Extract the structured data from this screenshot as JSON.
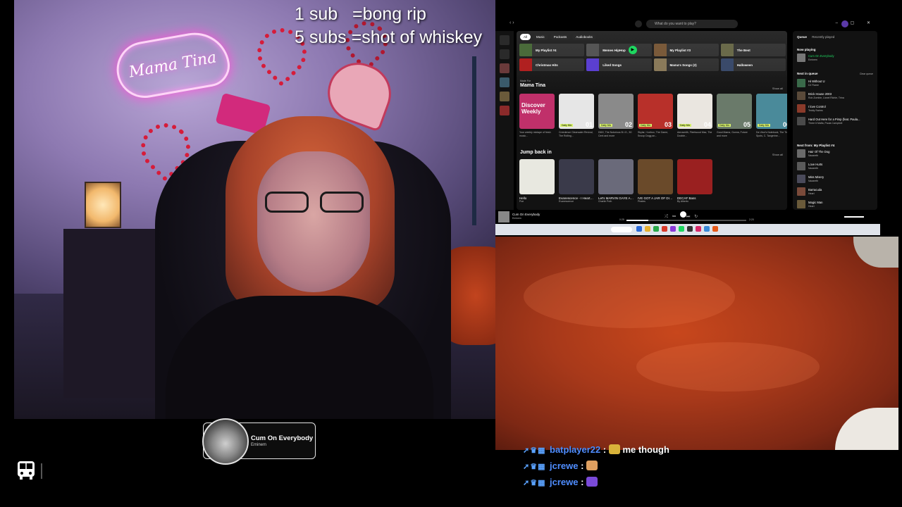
{
  "overlay": {
    "sub_rules_line1": "1 sub   =bong rip",
    "sub_rules_line2": "5 subs =shot of whiskey"
  },
  "webcam": {
    "neon_sign": "Mama Tina"
  },
  "now_playing_widget": {
    "title": "Cum On Everybody",
    "artist": "Eminem"
  },
  "spotify": {
    "search_placeholder": "What do you want to play?",
    "chips": [
      "All",
      "Music",
      "Podcasts",
      "Audiobooks"
    ],
    "shortcuts": [
      {
        "name": "My Playlist #4",
        "color": "#4a6b3a"
      },
      {
        "name": "Memes HipHop",
        "color": "#555555"
      },
      {
        "name": "My Playlist #3",
        "color": "#7a5a3a"
      },
      {
        "name": "The Best",
        "color": "#6a6a4a"
      },
      {
        "name": "Christmas Hits",
        "color": "#b02020"
      },
      {
        "name": "Liked Songs",
        "color": "#5b3fd1"
      },
      {
        "name": "Mama's Songs (2)",
        "color": "#8a7a5a"
      },
      {
        "name": "Halloween",
        "color": "#3a4a6a"
      }
    ],
    "made_for_label": "Made For",
    "made_for_title": "Mama Tina",
    "show_all": "Show all",
    "mixes": [
      {
        "name": "Discover Weekly",
        "desc": "Your weekly mixtape of fresh music...",
        "color": "#c0306a",
        "badge": "",
        "num": ""
      },
      {
        "name": "Daily Mix 1",
        "desc": "Creedence Clearwater Revival, The Rolling...",
        "color": "#e6e6e6",
        "badge": "Daily Mix",
        "num": "01"
      },
      {
        "name": "Daily Mix 2",
        "desc": "DMX, The Notorious B.I.G., 50 Cent and more",
        "color": "#8a8a8a",
        "badge": "Daily Mix",
        "num": "02"
      },
      {
        "name": "Daily Mix 3",
        "desc": "Skylar, I Icebox, The Game, Snoop Dogg an...",
        "color": "#b8302a",
        "badge": "Daily Mix",
        "num": "03"
      },
      {
        "name": "Daily Mix 4",
        "desc": "Aerosmith, Fleetwood Mac, The Doobie...",
        "color": "#eae6e0",
        "badge": "Daily Mix",
        "num": "04"
      },
      {
        "name": "Daily Mix 5",
        "desc": "Good Mama, Gunna, Future and more",
        "color": "#6a7a6a",
        "badge": "Daily Mix",
        "num": "05"
      },
      {
        "name": "Daily Mix 6",
        "desc": "Da Vinci's Notebook, The Tin Spots, C. Tangerine...",
        "color": "#4a8a9a",
        "badge": "Daily Mix",
        "num": "06"
      }
    ],
    "jump_back_title": "Jump back in",
    "jump_back": [
      {
        "name": "Hello",
        "sub": "Poe",
        "color": "#e8e8e0"
      },
      {
        "name": "Evanescence - I Heart Shaped Box",
        "sub": "Evanescence",
        "color": "#3a3a4a"
      },
      {
        "name": "Let's MARVIN GAYE AND GET IT ON WI...",
        "sub": "Charlie Puth",
        "color": "#6a6a7a"
      },
      {
        "name": "IVE GOT A JAR OF DIRT",
        "sub": "Pirates",
        "color": "#6a4a2a"
      },
      {
        "name": "DECAF Bass",
        "sub": "By Alberto",
        "color": "#9a2020"
      }
    ],
    "queue": {
      "tab_queue": "Queue",
      "tab_recent": "Recently played",
      "now_playing_label": "Now playing",
      "now_playing": {
        "title": "Cum On Everybody",
        "artist": "Eminem",
        "color": "#777777"
      },
      "next_in_queue_label": "Next in queue",
      "clear_queue": "Clear queue",
      "next": [
        {
          "title": "Hi Without U",
          "artist": "DJ Flame",
          "color": "#3a6a4a"
        },
        {
          "title": "Brick House 2003",
          "artist": "Rob Zombie, Lionel Richie, Trina",
          "color": "#5a4a3a"
        },
        {
          "title": "I love Control",
          "artist": "Teddy Swims",
          "color": "#8a3a2a"
        },
        {
          "title": "Hard Out Here for a Pimp (feat. Paula...",
          "artist": "Three 6 Mafia, Paula Campbell",
          "color": "#4a4a4a"
        }
      ],
      "next_from_label": "Next from: My Playlist #4",
      "next_from": [
        {
          "title": "Hair Of The Dog",
          "artist": "Nazareth",
          "color": "#6a6a6a"
        },
        {
          "title": "Love Hurts",
          "artist": "Nazareth",
          "color": "#5a5a5a"
        },
        {
          "title": "Miss Misery",
          "artist": "Nazareth",
          "color": "#4a4a5a"
        },
        {
          "title": "Barracuda",
          "artist": "Heart",
          "color": "#7a4a3a"
        },
        {
          "title": "Magic Man",
          "artist": "Heart",
          "color": "#6a5a3a"
        }
      ]
    },
    "player": {
      "title": "Cum On Everybody",
      "artist": "Eminem",
      "elapsed": "0:25",
      "duration": "2:20",
      "progress": 0.18
    }
  },
  "chat": [
    {
      "user": "batplayer22",
      "message": "me though",
      "emote_color": "#d9b33a"
    },
    {
      "user": "jcrewe",
      "message": "",
      "emote_color": "#e0a060"
    },
    {
      "user": "jcrewe",
      "message": "",
      "emote_color": "#7a4ad8"
    }
  ]
}
